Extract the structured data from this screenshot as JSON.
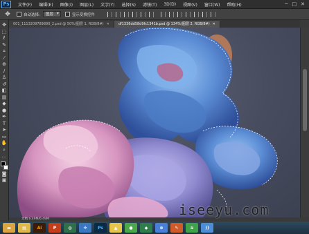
{
  "app": {
    "logo": "Ps",
    "menu": [
      "文件(F)",
      "编辑(E)",
      "图像(I)",
      "图层(L)",
      "文字(Y)",
      "选择(S)",
      "滤镜(T)",
      "3D(D)",
      "视图(V)",
      "窗口(W)",
      "帮助(H)"
    ],
    "window_controls": [
      "─",
      "□",
      "✕"
    ]
  },
  "options": {
    "tool_glyph": "✥",
    "auto_select_label": "自动选择:",
    "auto_select_value": "图层",
    "show_transform_label": "显示变换控件"
  },
  "tabs": [
    {
      "label": "001_1113209789890_2.psd @ 50%(图层 1, RGB/8#)",
      "close": "✕",
      "active": false
    },
    {
      "label": "df1336dd58d9fc1341b.psd @ 134%(图层 2, RGB/8#)",
      "close": "✕",
      "active": true
    }
  ],
  "status": {
    "doc_info": "文档:6.49M/6.49M"
  },
  "watermark": "iseeyu.com",
  "taskbar": {
    "apps": [
      {
        "name": "explorer",
        "glyph": "▬",
        "color": "#d9a441"
      },
      {
        "name": "folder",
        "glyph": "▤",
        "color": "#e0b94a"
      },
      {
        "name": "illustrator",
        "glyph": "Ai",
        "color": "#3b1c07",
        "text": "#ff9a00"
      },
      {
        "name": "powerpoint",
        "glyph": "P",
        "color": "#c43e1c"
      },
      {
        "name": "browser",
        "glyph": "◍",
        "color": "#2f6f4a"
      },
      {
        "name": "app-blue",
        "glyph": "✣",
        "color": "#3a78c2"
      },
      {
        "name": "photoshop",
        "glyph": "Ps",
        "color": "#0b2a45",
        "text": "#4fb3ff"
      },
      {
        "name": "drive",
        "glyph": "▲",
        "color": "#e8c44a"
      },
      {
        "name": "media",
        "glyph": "●",
        "color": "#4aa84a"
      },
      {
        "name": "app-shield",
        "glyph": "◆",
        "color": "#2f7d4a"
      },
      {
        "name": "app-blue2",
        "glyph": "⊗",
        "color": "#4a7fd8"
      },
      {
        "name": "tools",
        "glyph": "✎",
        "color": "#cf5a2a"
      },
      {
        "name": "app-green",
        "glyph": "≋",
        "color": "#3fa148"
      },
      {
        "name": "rss",
        "glyph": "))",
        "color": "#4c8dd6"
      }
    ]
  }
}
